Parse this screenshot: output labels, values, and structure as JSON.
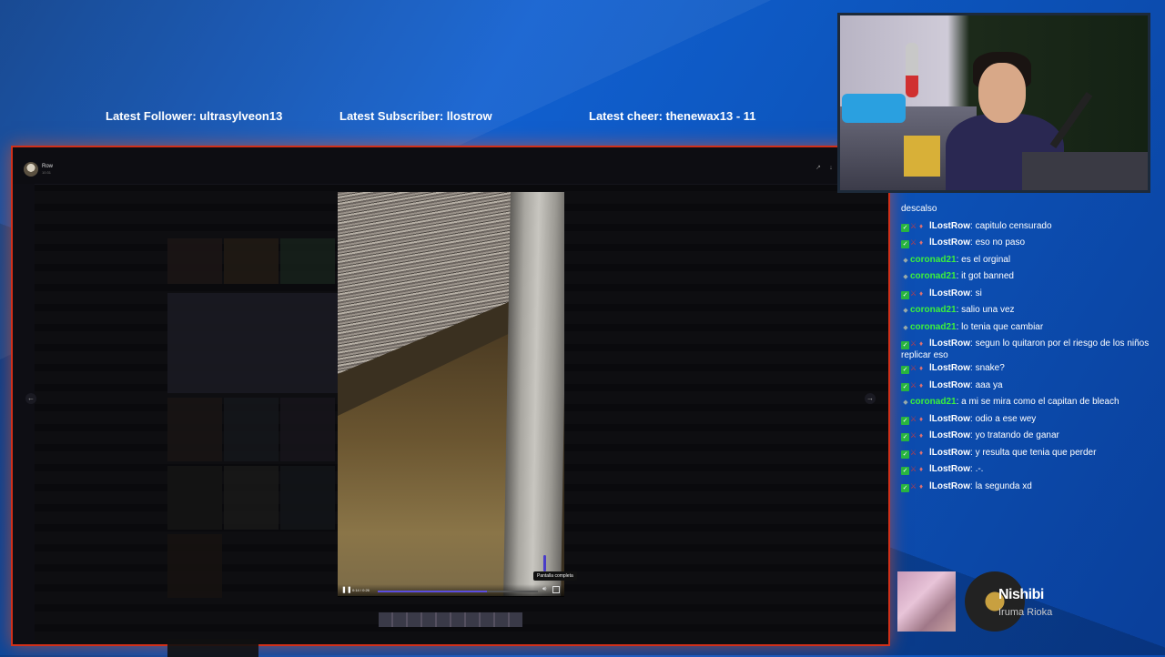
{
  "overlay": {
    "latest_follower": "Latest Follower: ultrasylveon13",
    "latest_subscriber": "Latest Subscriber: llostrow",
    "latest_cheer": "Latest cheer: thenewax13 - 11"
  },
  "window": {
    "title": "Row",
    "subtitle": "10:31"
  },
  "player": {
    "time": "0:14 / 0:26",
    "progress": 0.68,
    "tooltip": "Pantalla completa"
  },
  "chat": {
    "messages": [
      {
        "user": "",
        "text": "descalso",
        "kind": "plain"
      },
      {
        "user": "lLostRow",
        "text": "capitulo censurado",
        "kind": "lr"
      },
      {
        "user": "lLostRow",
        "text": "eso no paso",
        "kind": "lr"
      },
      {
        "user": "coronad21",
        "text": "es el orginal",
        "kind": "co"
      },
      {
        "user": "coronad21",
        "text": "it got banned",
        "kind": "co"
      },
      {
        "user": "lLostRow",
        "text": "si",
        "kind": "lr"
      },
      {
        "user": "coronad21",
        "text": "salio una vez",
        "kind": "co"
      },
      {
        "user": "coronad21",
        "text": "lo tenia que cambiar",
        "kind": "co"
      },
      {
        "user": "lLostRow",
        "text": "segun lo quitaron por el riesgo de los niños replicar eso",
        "kind": "lr"
      },
      {
        "user": "lLostRow",
        "text": "snake?",
        "kind": "lr"
      },
      {
        "user": "lLostRow",
        "text": "aaa ya",
        "kind": "lr"
      },
      {
        "user": "coronad21",
        "text": "a mi se mira como el capitan de bleach",
        "kind": "co"
      },
      {
        "user": "lLostRow",
        "text": "odio a ese wey",
        "kind": "lr"
      },
      {
        "user": "lLostRow",
        "text": "yo tratando de ganar",
        "kind": "lr"
      },
      {
        "user": "lLostRow",
        "text": "y resulta que tenia que perder",
        "kind": "lr"
      },
      {
        "user": "lLostRow",
        "text": ".-.",
        "kind": "lr"
      },
      {
        "user": "lLostRow",
        "text": "la segunda xd",
        "kind": "lr"
      }
    ]
  },
  "now_playing": {
    "title": "Nishibi",
    "artist": "Iruma Rioka"
  },
  "colors": {
    "accent_frame": "#d0301a",
    "chat_user_coronad": "#3cf03c",
    "progress_fill": "#5b4de0"
  }
}
